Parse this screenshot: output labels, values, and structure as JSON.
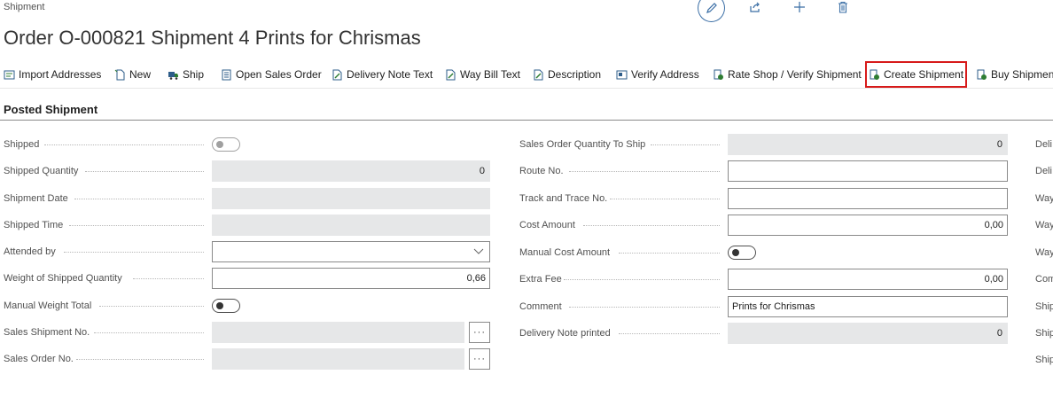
{
  "header": {
    "breadcrumb": "Shipment",
    "title": "Order O-000821 Shipment 4 Prints for Chrismas",
    "icons": [
      "edit-icon",
      "share-icon",
      "add-icon",
      "delete-icon"
    ]
  },
  "actions": [
    {
      "label": "Import Addresses",
      "icon": "import-addresses-icon"
    },
    {
      "label": "New",
      "icon": "new-icon"
    },
    {
      "label": "Ship",
      "icon": "ship-icon"
    },
    {
      "label": "Open Sales Order",
      "icon": "sales-order-icon"
    },
    {
      "label": "Delivery Note Text",
      "icon": "delivery-note-text-icon"
    },
    {
      "label": "Way Bill Text",
      "icon": "way-bill-text-icon"
    },
    {
      "label": "Description",
      "icon": "description-icon"
    },
    {
      "label": "Verify Address",
      "icon": "verify-address-icon"
    },
    {
      "label": "Rate Shop / Verify Shipment",
      "icon": "rate-shop-icon"
    },
    {
      "label": "Create Shipment",
      "icon": "create-shipment-icon",
      "highlighted": true
    },
    {
      "label": "Buy Shipment",
      "icon": "buy-shipment-icon"
    }
  ],
  "section": {
    "title": "Posted Shipment"
  },
  "left_fields": {
    "shipped": {
      "label": "Shipped",
      "value": false
    },
    "shipped_quantity": {
      "label": "Shipped Quantity",
      "value": "0"
    },
    "shipment_date": {
      "label": "Shipment Date",
      "value": ""
    },
    "shipped_time": {
      "label": "Shipped Time",
      "value": ""
    },
    "attended_by": {
      "label": "Attended by",
      "value": ""
    },
    "weight_shipped_quantity": {
      "label": "Weight of Shipped Quantity",
      "value": "0,66"
    },
    "manual_weight_total": {
      "label": "Manual Weight Total",
      "value": false
    },
    "sales_shipment_no": {
      "label": "Sales Shipment No.",
      "value": "",
      "assist": "···"
    },
    "sales_order_no": {
      "label": "Sales Order No.",
      "value": "",
      "assist": "···"
    }
  },
  "middle_fields": {
    "sales_order_qty_to_ship": {
      "label": "Sales Order Quantity To Ship",
      "value": "0"
    },
    "route_no": {
      "label": "Route No.",
      "value": ""
    },
    "track_trace_no": {
      "label": "Track and Trace No.",
      "value": ""
    },
    "cost_amount": {
      "label": "Cost Amount",
      "value": "0,00"
    },
    "manual_cost_amount": {
      "label": "Manual Cost Amount",
      "value": false
    },
    "extra_fee": {
      "label": "Extra Fee",
      "value": "0,00"
    },
    "comment": {
      "label": "Comment",
      "value": "Prints for Chrismas"
    },
    "delivery_note_printed": {
      "label": "Delivery Note printed",
      "value": "0"
    }
  },
  "right_fields_cut": [
    "Deli",
    "Deli",
    "Way",
    "Way",
    "Way",
    "Com",
    "Ship",
    "Ship",
    "Ship"
  ],
  "colors": {
    "accent": "#3a6ea5",
    "highlight_border": "#d71a1a",
    "readonly_bg": "#e6e7e8"
  }
}
